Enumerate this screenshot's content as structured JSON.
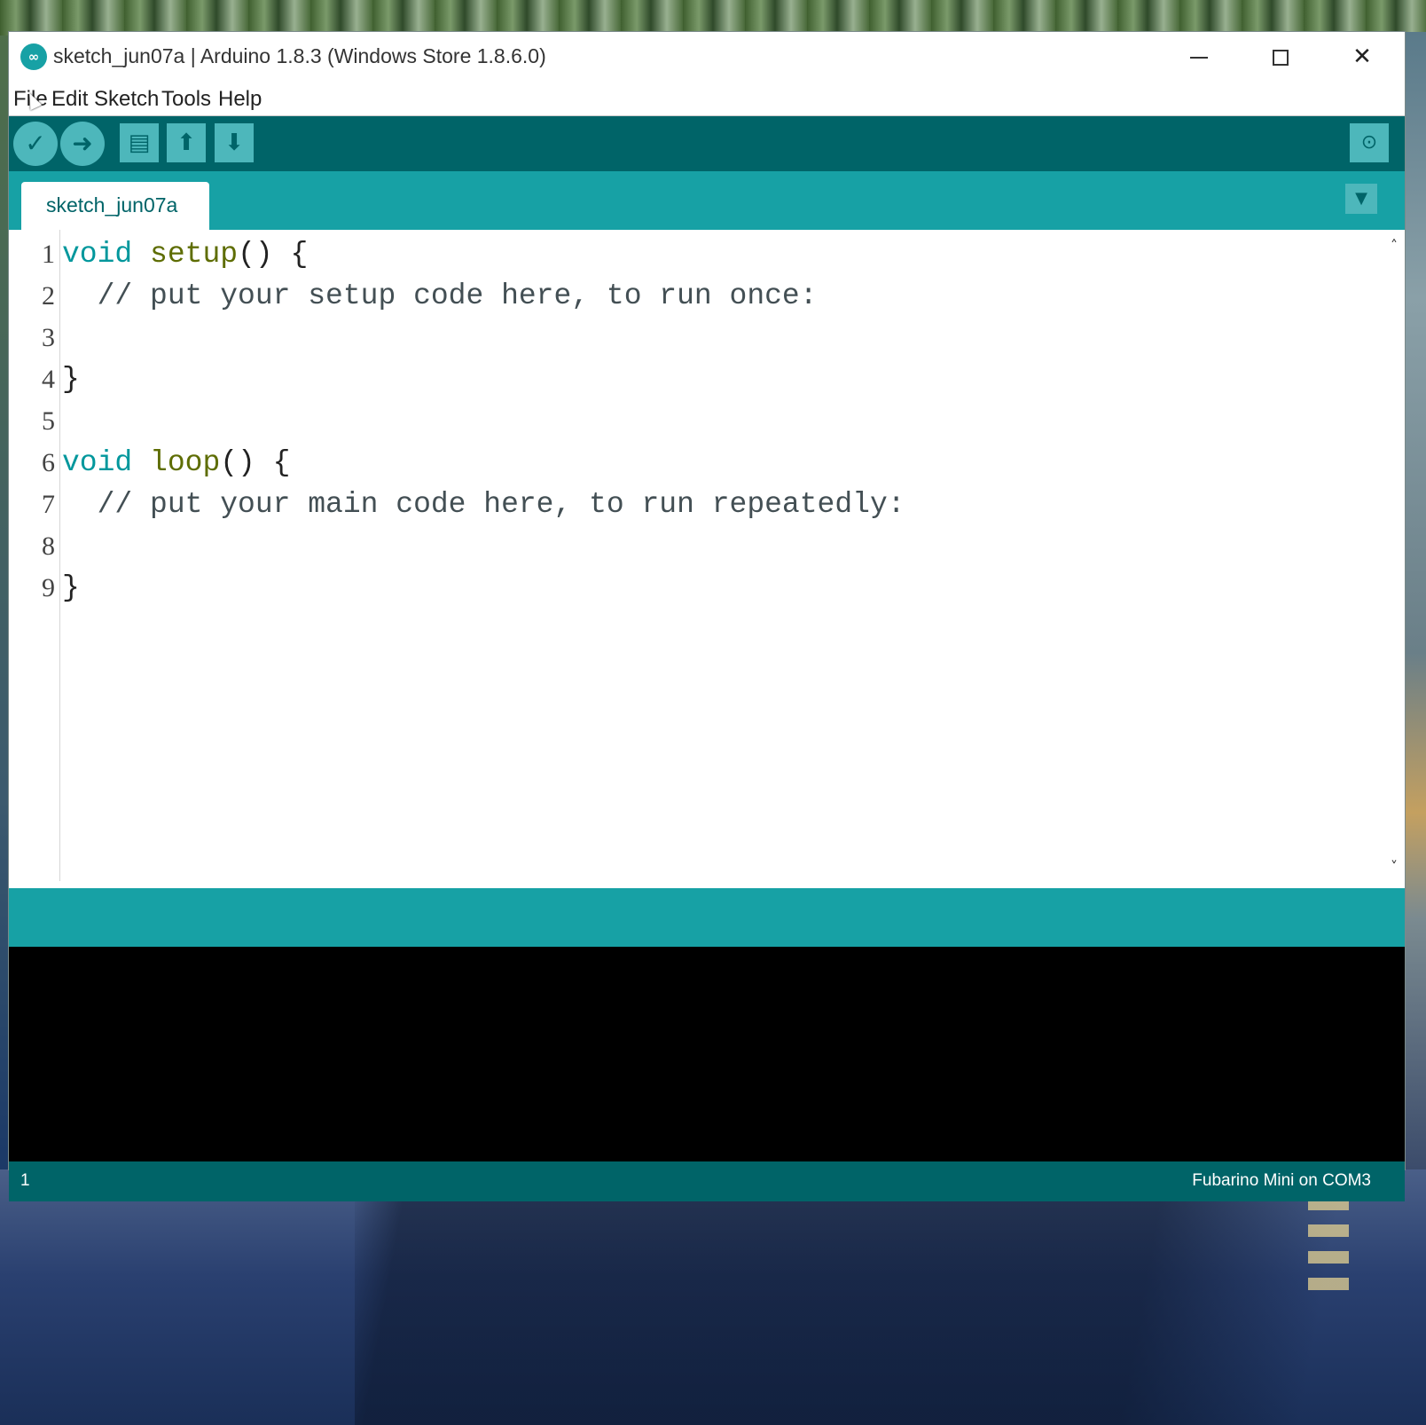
{
  "window": {
    "title": "sketch_jun07a | Arduino 1.8.3 (Windows Store 1.8.6.0)",
    "logo_glyph": "∞",
    "controls": {
      "minimize": "minimize",
      "maximize": "maximize",
      "close": "✕"
    }
  },
  "menu": [
    "File",
    "Edit",
    "Sketch",
    "Tools",
    "Help"
  ],
  "toolbar": {
    "verify_icon": "✓",
    "upload_icon": "➜",
    "new_icon": "▤",
    "open_icon": "⬆",
    "save_icon": "⬇",
    "serial_monitor_icon": "⊙"
  },
  "tabs": [
    {
      "label": "sketch_jun07a"
    }
  ],
  "tab_menu_icon": "▼",
  "editor": {
    "line_numbers": [
      "1",
      "2",
      "3",
      "4",
      "5",
      "6",
      "7",
      "8",
      "9"
    ],
    "lines": [
      {
        "kw": "void",
        "fn": "setup",
        "rest": "() {"
      },
      {
        "comment": "  // put your setup code here, to run once:"
      },
      {
        "comment": ""
      },
      {
        "comment": "}"
      },
      {
        "comment": ""
      },
      {
        "kw": "void",
        "fn": "loop",
        "rest": "() {"
      },
      {
        "comment": "  // put your main code here, to run repeatedly:"
      },
      {
        "comment": ""
      },
      {
        "comment": "}"
      }
    ],
    "scroll_up_icon": "˄",
    "scroll_down_icon": "˅"
  },
  "footer": {
    "line": "1",
    "board": "Fubarino Mini on COM3"
  },
  "colors": {
    "toolbar": "#006468",
    "tabbar": "#17a1a5",
    "keyword": "#00979c",
    "function": "#5e6d03",
    "console": "#000000"
  }
}
